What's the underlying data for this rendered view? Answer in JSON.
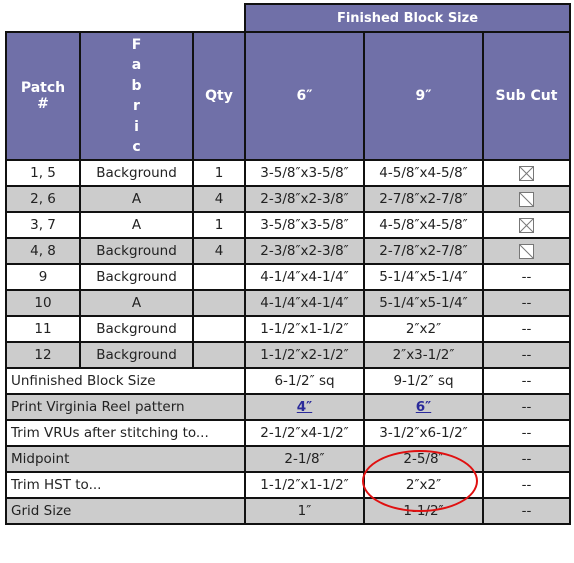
{
  "header": {
    "group_label": "Finished Block Size",
    "columns": [
      "Patch #",
      "Fabric",
      "Qty",
      "6″",
      "9″",
      "Sub Cut"
    ],
    "patch_label_line1": "Patch",
    "patch_label_line2": "#",
    "fabric_letters": [
      "F",
      "a",
      "b",
      "r",
      "i",
      "c"
    ]
  },
  "rows": [
    {
      "patch": "1, 5",
      "fabric": "Background",
      "qty": "1",
      "six": "3-5/8″x3-5/8″",
      "nine": "4-5/8″x4-5/8″",
      "subcut": "quarter-square-x-icon"
    },
    {
      "patch": "2, 6",
      "fabric": "A",
      "qty": "4",
      "six": "2-3/8″x2-3/8″",
      "nine": "2-7/8″x2-7/8″",
      "subcut": "half-square-diagonal-icon"
    },
    {
      "patch": "3, 7",
      "fabric": "A",
      "qty": "1",
      "six": "3-5/8″x3-5/8″",
      "nine": "4-5/8″x4-5/8″",
      "subcut": "quarter-square-x-icon"
    },
    {
      "patch": "4, 8",
      "fabric": "Background",
      "qty": "4",
      "six": "2-3/8″x2-3/8″",
      "nine": "2-7/8″x2-7/8″",
      "subcut": "half-square-diagonal-icon"
    },
    {
      "patch": "9",
      "fabric": "Background",
      "qty": "",
      "six": "4-1/4″x4-1/4″",
      "nine": "5-1/4″x5-1/4″",
      "subcut": "--"
    },
    {
      "patch": "10",
      "fabric": "A",
      "qty": "",
      "six": "4-1/4″x4-1/4″",
      "nine": "5-1/4″x5-1/4″",
      "subcut": "--"
    },
    {
      "patch": "11",
      "fabric": "Background",
      "qty": "",
      "six": "1-1/2″x1-1/2″",
      "nine": "2″x2″",
      "subcut": "--"
    },
    {
      "patch": "12",
      "fabric": "Background",
      "qty": "",
      "six": "1-1/2″x2-1/2″",
      "nine": "2″x3-1/2″",
      "subcut": "--"
    }
  ],
  "summary_rows": [
    {
      "label": "Unfinished Block Size",
      "six": "6-1/2″ sq",
      "nine": "9-1/2″ sq",
      "subcut": "--"
    },
    {
      "label": "Print Virginia Reel pattern",
      "six": "4″",
      "nine": "6″",
      "subcut": "--",
      "links": true
    },
    {
      "label": "Trim VRUs after stitching to...",
      "six": "2-1/2″x4-1/2″",
      "nine": "3-1/2″x6-1/2″",
      "subcut": "--"
    },
    {
      "label": "Midpoint",
      "six": "2-1/8″",
      "nine": "2-5/8″",
      "subcut": "--",
      "highlighted": "nine"
    },
    {
      "label": "Trim HST to...",
      "six": "1-1/2″x1-1/2″",
      "nine": "2″x2″",
      "subcut": "--"
    },
    {
      "label": "Grid Size",
      "six": "1″",
      "nine": "1-1/2″",
      "subcut": "--"
    }
  ],
  "colors": {
    "header_bg": "#7070a8",
    "alt_row": "#cccccc",
    "link": "#2a2a9a",
    "annotation": "#e01010"
  }
}
